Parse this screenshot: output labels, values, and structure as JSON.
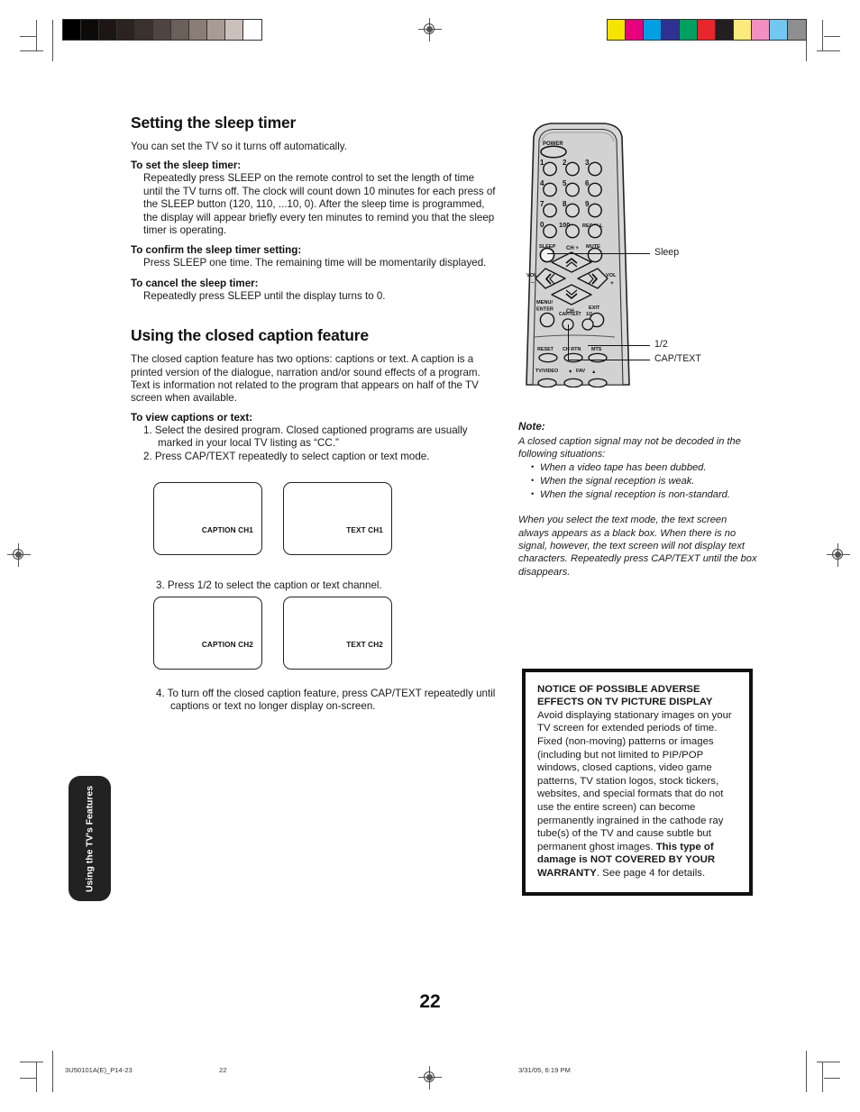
{
  "page": {
    "number": "22",
    "side_tab_label": "Using the TV's Features"
  },
  "calibration": {
    "gray_wedge": [
      "#000000",
      "#0d0b0a",
      "#1c1715",
      "#2b2320",
      "#3a302c",
      "#4f443f",
      "#6b5f59",
      "#8a7d76",
      "#a89b94",
      "#cbc0ba",
      "#ffffff"
    ],
    "color_bar": [
      "#f5e400",
      "#e6007e",
      "#00a0e3",
      "#2e3192",
      "#00a160",
      "#e8262c",
      "#231f20",
      "#fbea7c",
      "#f290c2",
      "#72c8ef",
      "#8e8e8e"
    ]
  },
  "left_column": {
    "section1": {
      "title": "Setting the sleep timer",
      "lead": "You can set the TV so it turns off automatically.",
      "sub1_head": "To set the sleep timer:",
      "sub1_body": "Repeatedly press SLEEP on the remote control to set the length of time until the TV turns off. The clock will count down 10 minutes for each press of the SLEEP button (120, 110, ...10, 0). After the sleep time is programmed, the display will appear briefly every ten minutes to remind you that the sleep timer is operating.",
      "sub2_head": "To confirm the sleep timer setting:",
      "sub2_body": "Press SLEEP one time. The remaining time will be momentarily displayed.",
      "sub3_head": "To cancel the sleep timer:",
      "sub3_body": "Repeatedly press SLEEP until the display turns to 0."
    },
    "section2": {
      "title": "Using the closed caption feature",
      "lead": "The closed caption feature has two options: captions or text. A caption is a printed version of the dialogue, narration and/or sound effects of a program. Text is information not related to the program that appears on half of the TV screen when available.",
      "sub_head": "To view captions or text:",
      "step1": "1. Select the desired program. Closed captioned programs are usually marked in your local TV listing as “CC.”",
      "step2": "2. Press CAP/TEXT repeatedly to select caption or text mode.",
      "step3": "3. Press 1/2 to select the caption or text channel.",
      "step4": "4. To turn off the closed caption feature, press CAP/TEXT repeatedly until captions or text no longer display on-screen."
    },
    "tv_screens_row1": [
      {
        "label": "CAPTION CH1"
      },
      {
        "label": "TEXT CH1"
      }
    ],
    "tv_screens_row2": [
      {
        "label": "CAPTION CH2"
      },
      {
        "label": "TEXT CH2"
      }
    ]
  },
  "remote": {
    "buttons": {
      "power": "POWER",
      "keys": [
        "1",
        "2",
        "3",
        "4",
        "5",
        "6",
        "7",
        "8",
        "9"
      ],
      "zero": "0",
      "hundred": "100",
      "recall": "RECALL",
      "sleep": "SLEEP",
      "mute": "MUTE",
      "ch_up": "CH +",
      "ch_down": "CH –",
      "vol_left_top": "VOL",
      "vol_left_bottom": "–",
      "vol_right_top": "VOL",
      "vol_right_bottom": "+",
      "menu_line1": "MENU/",
      "menu_line2": "ENTER",
      "exit": "EXIT",
      "captext": "CAP/TEXT",
      "half": "1/2",
      "reset": "RESET",
      "chrtn": "CH RTN",
      "mts": "MTS",
      "tvvideo": "TV/VIDEO",
      "fav": "FAV",
      "fav_down": "▼",
      "fav_up": "▲"
    },
    "callouts": [
      {
        "label": "Sleep"
      },
      {
        "label": "1/2"
      },
      {
        "label": "CAP/TEXT"
      }
    ]
  },
  "right_column": {
    "note": {
      "heading": "Note:",
      "intro": "A closed caption signal may not be decoded in the following situations:",
      "bullets": [
        "When a video tape has been dubbed.",
        "When the signal reception is weak.",
        "When the signal reception is non-standard."
      ],
      "paragraph": "When you select the text mode, the text screen always appears as a black box. When there is no signal, however, the text screen will not display text characters. Repeatedly press CAP/TEXT until the box disappears."
    },
    "notice": {
      "title_line1": "NOTICE OF POSSIBLE ADVERSE",
      "title_line2": "EFFECTS ON TV PICTURE DISPLAY",
      "body_part1": "Avoid displaying stationary images on your TV screen for extended periods of time. Fixed (non-moving) patterns or images (including but not limited to PIP/POP windows, closed captions, video game patterns, TV station logos, stock tickers, websites, and special formats that do not use the entire screen) can become permanently ingrained in the cathode ray tube(s) of the TV and cause subtle but permanent ghost images. ",
      "body_bold": "This type of damage is NOT COVERED BY YOUR WARRANTY",
      "body_part2": ". See page 4 for details."
    }
  },
  "footer": {
    "file_id": "3U50101A(E)_P14-23",
    "page": "22",
    "timestamp": "3/31/05, 6:19 PM"
  }
}
